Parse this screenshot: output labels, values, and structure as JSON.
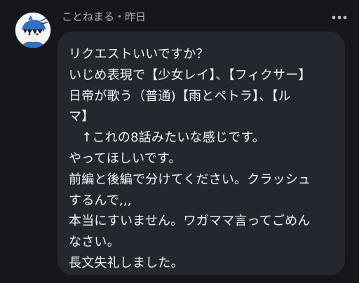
{
  "header": {
    "meta": "ことねまる・昨日"
  },
  "icons": {
    "avatar": "avatar-illustration",
    "more": "more-horizontal-icon"
  },
  "message": {
    "lines": [
      "リクエストいいですか？",
      "いじめ表現で【少女レイ】、【フィクサー】",
      "日帝が歌う（普通)【雨とペトラ】、【ル",
      "マ】",
      "　↑これの8話みたいな感じです。",
      "やってほしいです。",
      "前編と後編で分けてください。クラッシュ",
      "するんで,,,",
      "本当にすいません。ワガママ言ってごめん",
      "なさい。",
      "長文失礼しました。"
    ]
  },
  "colors": {
    "background": "#15171c",
    "bubble": "#24272e",
    "text": "#f5f6f8",
    "meta": "#a9adb5"
  }
}
